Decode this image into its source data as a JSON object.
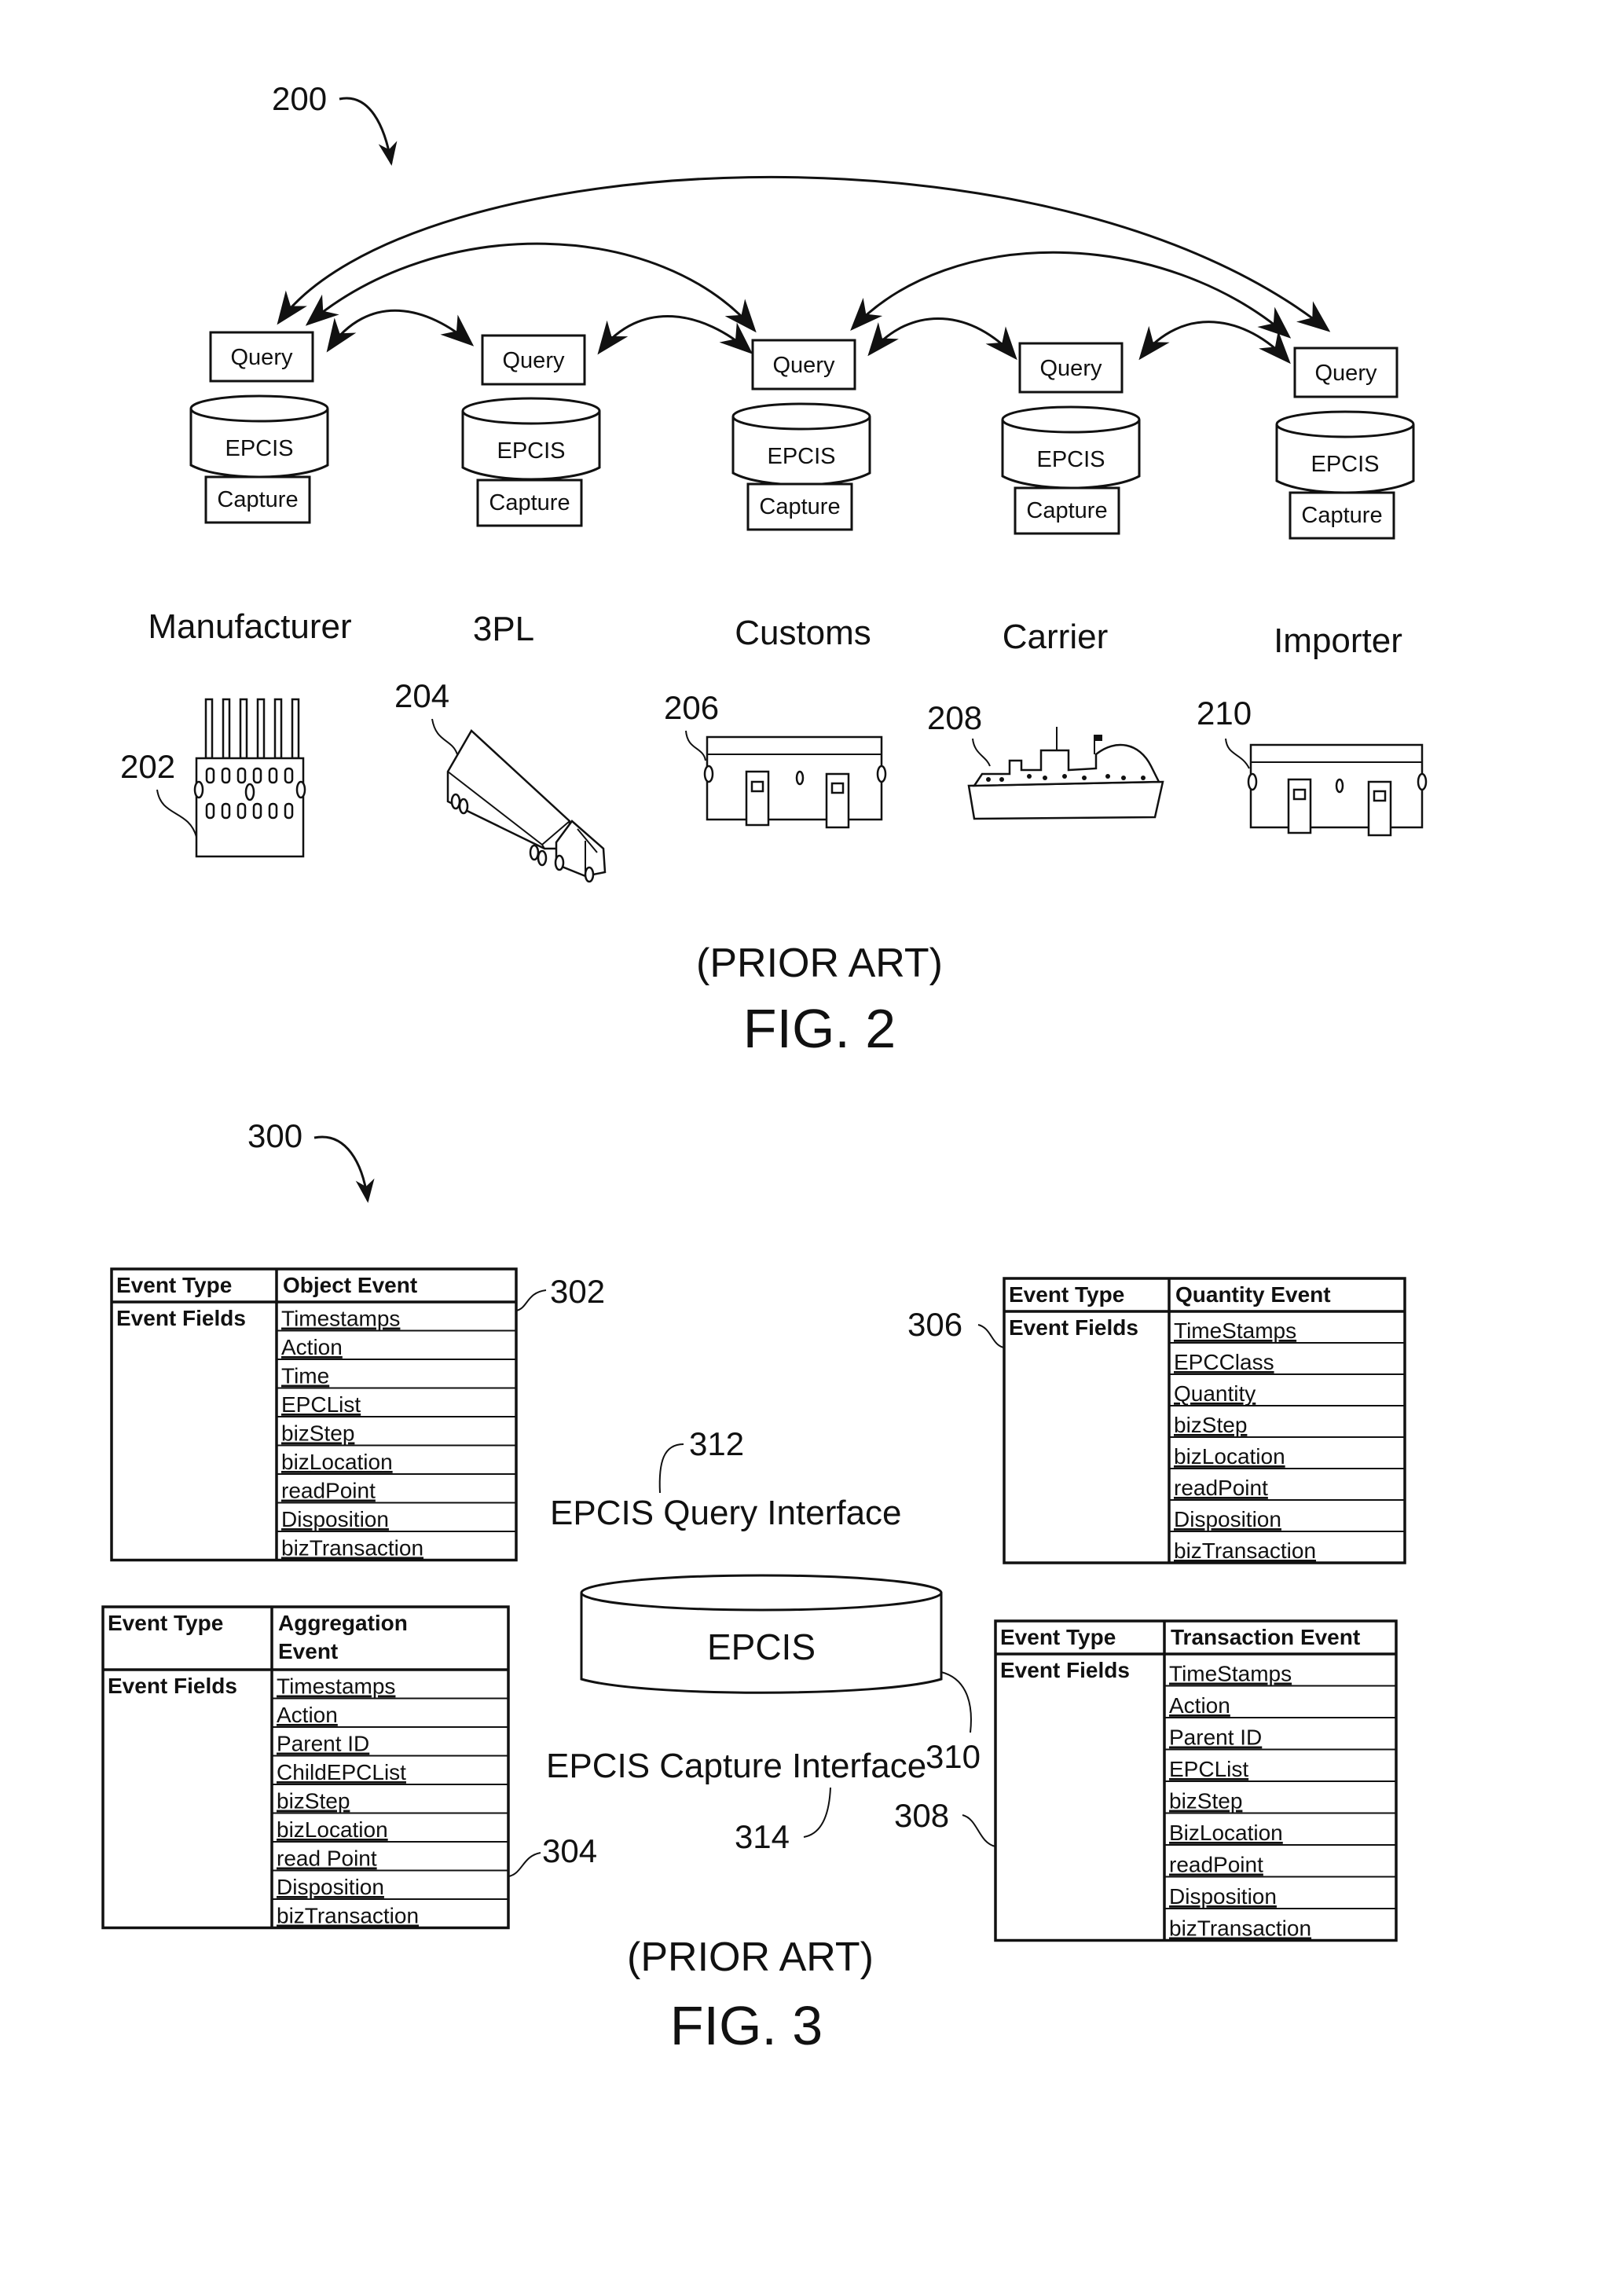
{
  "fig2": {
    "ref": "200",
    "caption_prior": "(PRIOR ART)",
    "caption_fig": "FIG. 2",
    "node_labels": {
      "query": "Query",
      "epcis": "EPCIS",
      "capture": "Capture"
    },
    "nodes": [
      {
        "actor": "Manufacturer",
        "ref": "202",
        "icon": "factory-icon"
      },
      {
        "actor": "3PL",
        "ref": "204",
        "icon": "truck-icon"
      },
      {
        "actor": "Customs",
        "ref": "206",
        "icon": "warehouse-icon"
      },
      {
        "actor": "Carrier",
        "ref": "208",
        "icon": "ship-icon"
      },
      {
        "actor": "Importer",
        "ref": "210",
        "icon": "warehouse-icon"
      }
    ],
    "connections": [
      {
        "from": "Manufacturer",
        "to": "3PL"
      },
      {
        "from": "3PL",
        "to": "Customs"
      },
      {
        "from": "Customs",
        "to": "Carrier"
      },
      {
        "from": "Carrier",
        "to": "Importer"
      },
      {
        "from": "Manufacturer",
        "to": "Customs"
      },
      {
        "from": "Customs",
        "to": "Importer"
      },
      {
        "from": "Manufacturer",
        "to": "Importer"
      }
    ]
  },
  "fig3": {
    "ref": "300",
    "caption_prior": "(PRIOR ART)",
    "caption_fig": "FIG. 3",
    "epcis": {
      "label": "EPCIS",
      "ref": "310"
    },
    "query_interface": {
      "label": "EPCIS Query Interface",
      "ref": "312"
    },
    "capture_interface": {
      "label": "EPCIS Capture Interface",
      "ref": "314"
    },
    "tables": [
      {
        "ref": "302",
        "type_label": "Event Type",
        "fields_label": "Event Fields",
        "event": [
          "Object Event"
        ],
        "fields": [
          "Timestamps",
          "Action",
          "Time",
          "EPCList",
          "bizStep",
          "bizLocation",
          "readPoint",
          "Disposition",
          "bizTransaction"
        ]
      },
      {
        "ref": "304",
        "type_label": "Event Type",
        "fields_label": "Event Fields",
        "event": [
          "Aggregation",
          "Event"
        ],
        "fields": [
          "Timestamps",
          "Action",
          "Parent ID",
          "ChildEPCList",
          "bizStep",
          "bizLocation",
          "read Point",
          "Disposition",
          "bizTransaction"
        ]
      },
      {
        "ref": "306",
        "type_label": "Event Type",
        "fields_label": "Event Fields",
        "event": [
          "Quantity Event"
        ],
        "fields": [
          "TimeStamps",
          "EPCClass",
          "Quantity",
          "bizStep",
          "bizLocation",
          "readPoint",
          "Disposition",
          "bizTransaction"
        ]
      },
      {
        "ref": "308",
        "type_label": "Event Type",
        "fields_label": "Event Fields",
        "event": [
          "Transaction Event"
        ],
        "fields": [
          "TimeStamps",
          "Action",
          "Parent ID",
          "EPCList",
          "bizStep",
          "BizLocation",
          "readPoint",
          "Disposition",
          "bizTransaction"
        ]
      }
    ]
  }
}
